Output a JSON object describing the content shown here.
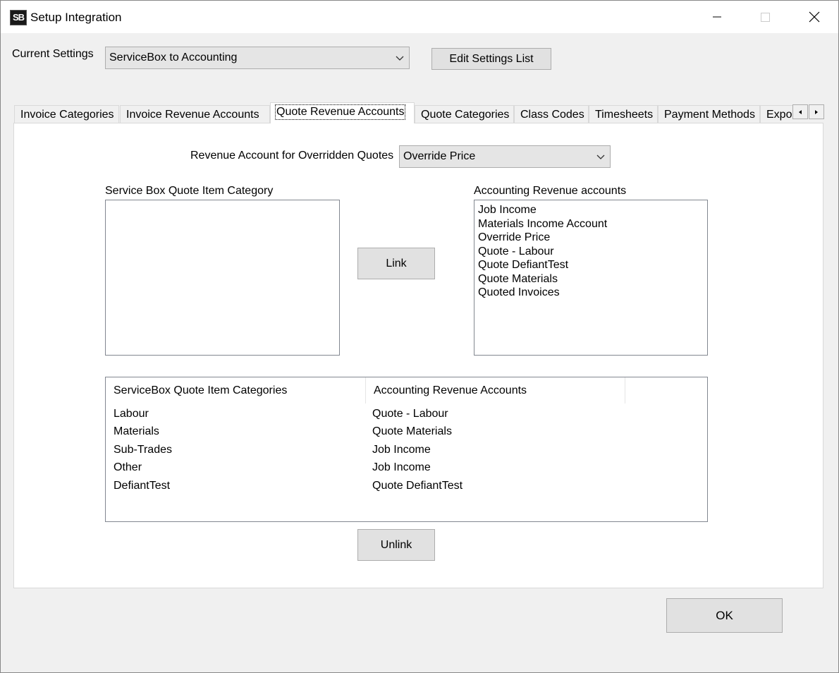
{
  "window": {
    "icon_text": "SB",
    "title": "Setup Integration"
  },
  "settings": {
    "label": "Current Settings",
    "selected": "ServiceBox to Accounting",
    "edit_button": "Edit Settings List"
  },
  "tabs": [
    {
      "label": "Invoice Categories"
    },
    {
      "label": "Invoice Revenue Accounts"
    },
    {
      "label": "Quote Revenue Accounts",
      "active": true
    },
    {
      "label": "Quote Categories"
    },
    {
      "label": "Class Codes"
    },
    {
      "label": "Timesheets"
    },
    {
      "label": "Payment Methods"
    },
    {
      "label": "Expo"
    }
  ],
  "override": {
    "label": "Revenue Account for Overridden Quotes",
    "selected": "Override Price"
  },
  "categories_list": {
    "label": "Service Box Quote Item Category",
    "items": []
  },
  "revenue_list": {
    "label": "Accounting Revenue accounts",
    "items": [
      "Job Income",
      "Materials Income Account",
      "Override Price",
      "Quote - Labour",
      "Quote DefiantTest",
      "Quote Materials",
      "Quoted Invoices"
    ]
  },
  "link_button": "Link",
  "unlink_button": "Unlink",
  "ok_button": "OK",
  "mapping_table": {
    "columns": [
      "ServiceBox Quote Item Categories",
      "Accounting Revenue Accounts"
    ],
    "rows": [
      {
        "category": "Labour",
        "account": "Quote - Labour"
      },
      {
        "category": "Materials",
        "account": "Quote Materials"
      },
      {
        "category": "Sub-Trades",
        "account": "Job Income"
      },
      {
        "category": "Other",
        "account": "Job Income"
      },
      {
        "category": "DefiantTest",
        "account": "Quote DefiantTest"
      }
    ]
  },
  "icons": {
    "minimize": "minimize-icon",
    "maximize": "maximize-icon",
    "close": "close-icon",
    "dropdown": "chevron-down-icon",
    "tab_left": "arrow-left-icon",
    "tab_right": "arrow-right-icon"
  }
}
